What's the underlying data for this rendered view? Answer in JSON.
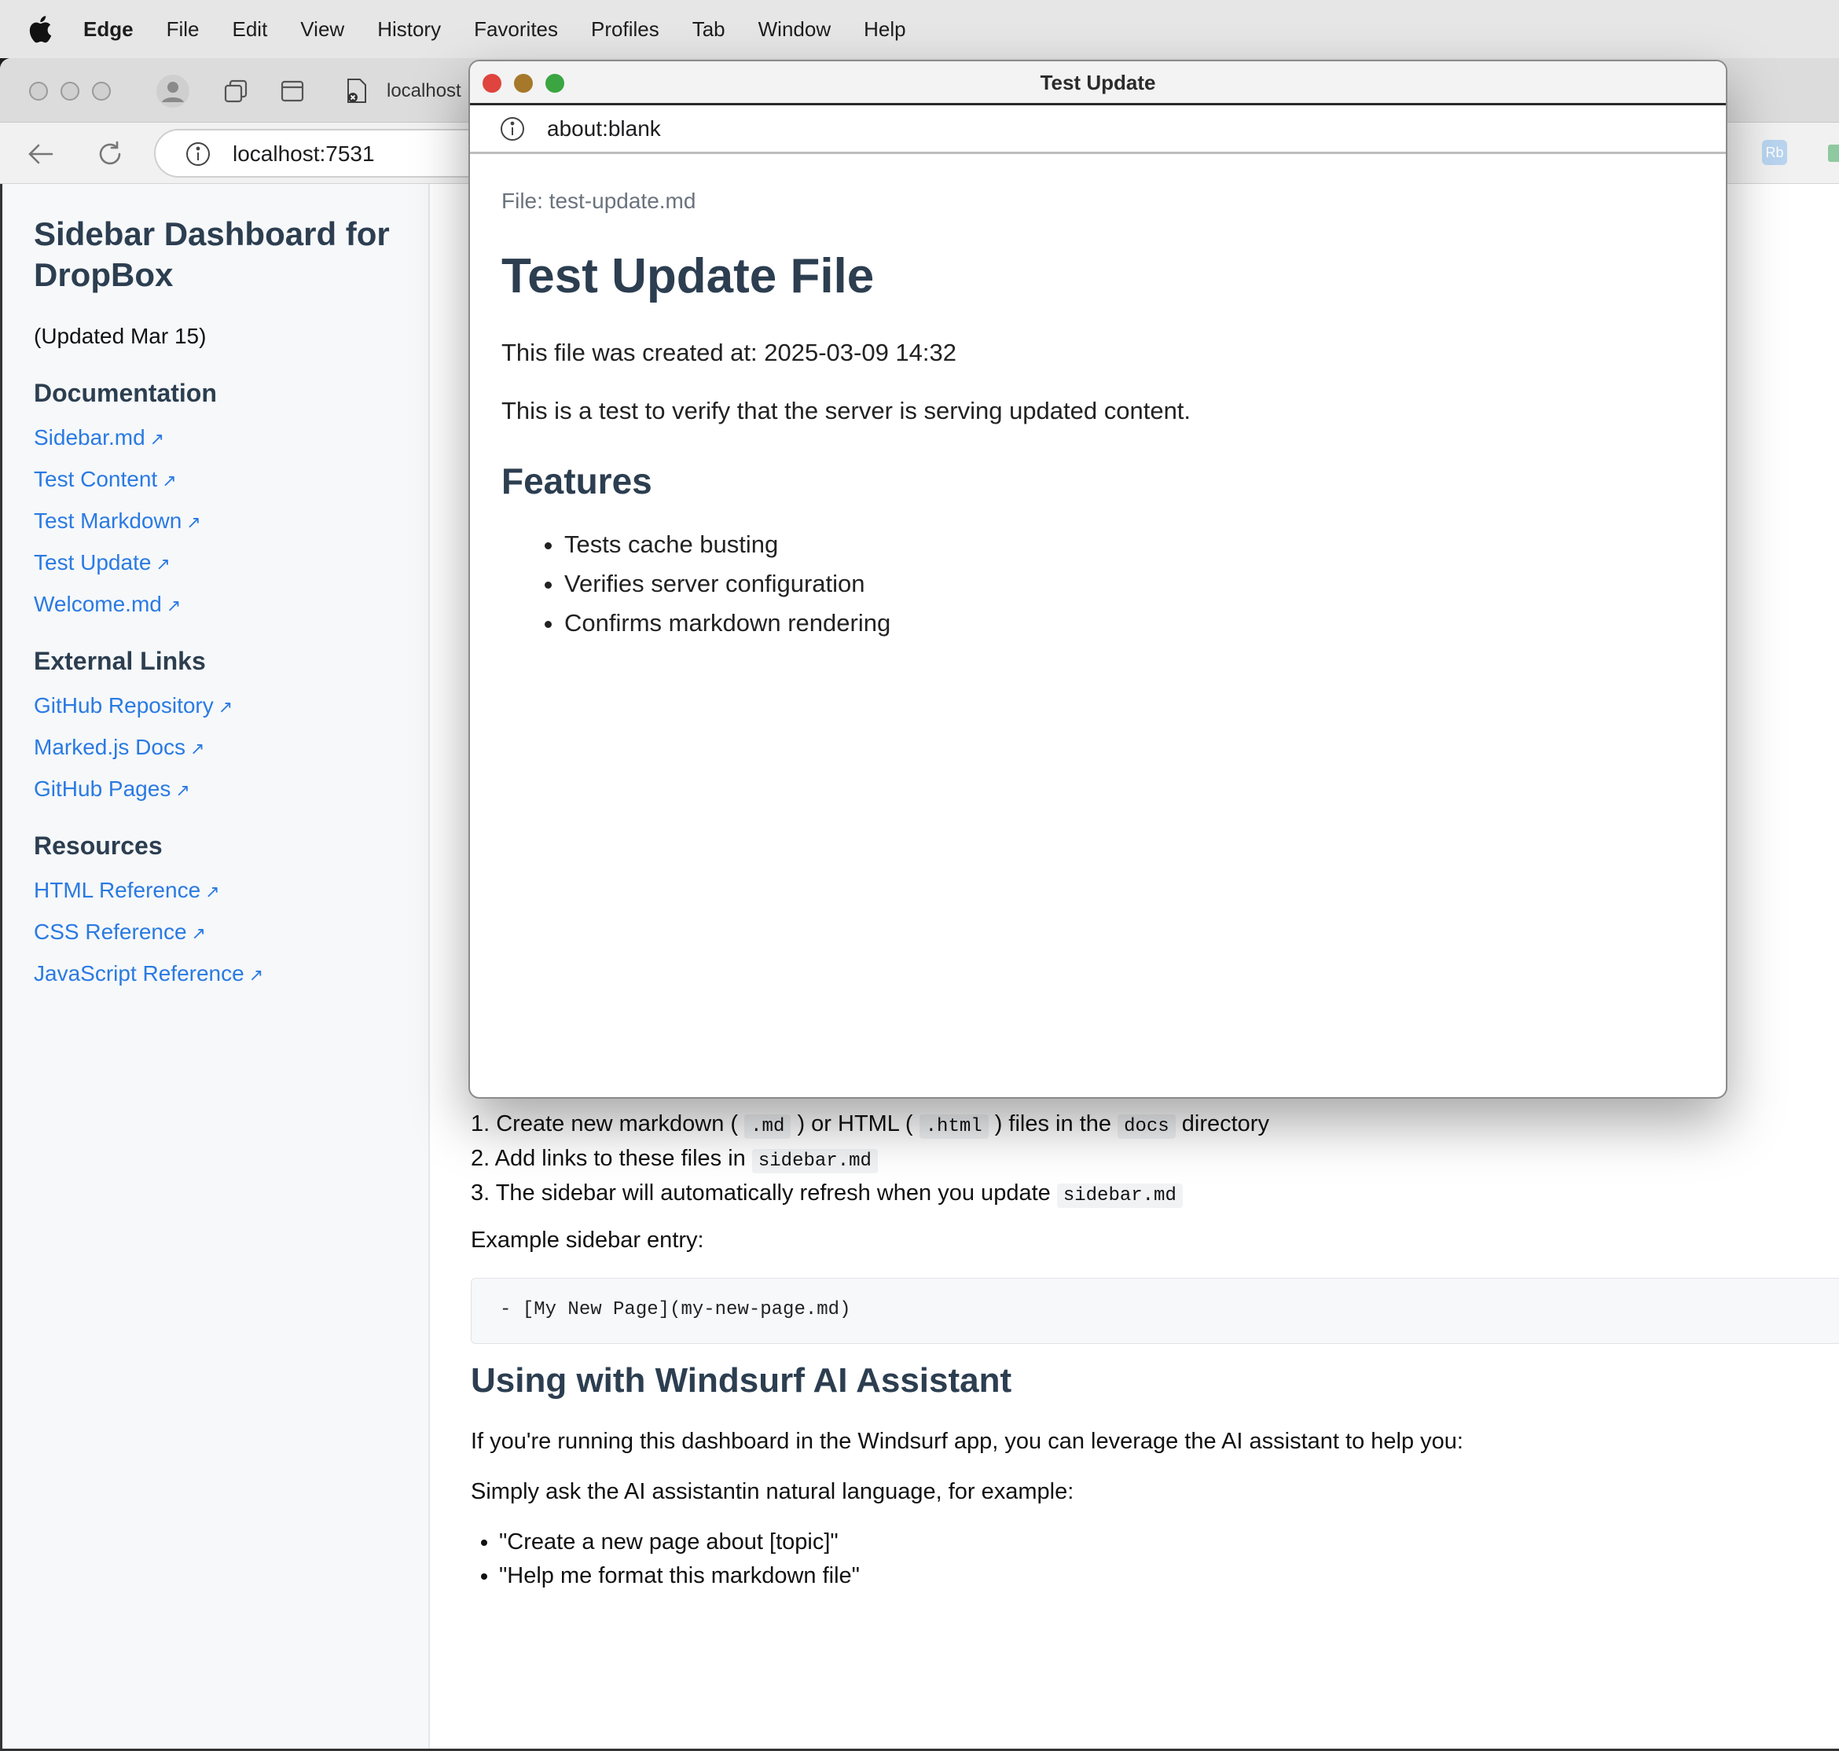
{
  "menubar": {
    "app": "Edge",
    "items": [
      "File",
      "Edit",
      "View",
      "History",
      "Favorites",
      "Profiles",
      "Tab",
      "Window",
      "Help"
    ]
  },
  "browser": {
    "tab_title": "localhost",
    "address": "localhost:7531",
    "extension_badge": "Rb"
  },
  "sidebar": {
    "title": "Sidebar Dashboard for DropBox",
    "updated": "(Updated Mar 15)",
    "sections": [
      {
        "heading": "Documentation",
        "links": [
          "Sidebar.md",
          "Test Content",
          "Test Markdown",
          "Test Update",
          "Welcome.md"
        ]
      },
      {
        "heading": "External Links",
        "links": [
          "GitHub Repository",
          "Marked.js Docs",
          "GitHub Pages"
        ]
      },
      {
        "heading": "Resources",
        "links": [
          "HTML Reference",
          "CSS Reference",
          "JavaScript Reference"
        ]
      }
    ],
    "external_glyph": "↗"
  },
  "main": {
    "steps": {
      "s1_a": "1. Create new markdown (",
      "s1_code1": ".md",
      "s1_b": ") or HTML (",
      "s1_code2": ".html",
      "s1_c": ") files in the",
      "s1_code3": "docs",
      "s1_d": "directory",
      "s2_a": "2. Add links to these files in",
      "s2_code": "sidebar.md",
      "s3_a": "3. The sidebar will automatically refresh when you update",
      "s3_code": "sidebar.md"
    },
    "example_label": "Example sidebar entry:",
    "code_example": "- [My New Page](my-new-page.md)",
    "windsurf_heading": "Using with Windsurf AI Assistant",
    "windsurf_para": "If you're running this dashboard in the Windsurf app, you can leverage the AI assistant to help you:",
    "ask_para": "Simply ask the AI assistantin natural language, for example:",
    "examples": [
      "\"Create a new page about [topic]\"",
      "\"Help me format this markdown file\""
    ]
  },
  "popup": {
    "title": "Test Update",
    "address": "about:blank",
    "file_label": "File: test-update.md",
    "heading": "Test Update File",
    "created": "This file was created at: 2025-03-09 14:32",
    "description": "This is a test to verify that the server is serving updated content.",
    "features_heading": "Features",
    "features": [
      "Tests cache busting",
      "Verifies server configuration",
      "Confirms markdown rendering"
    ]
  },
  "colors": {
    "link": "#2a7ae2",
    "heading": "#2c3e50",
    "close": "#e0443e",
    "minimize": "#a6782a",
    "zoom": "#3aa541"
  }
}
